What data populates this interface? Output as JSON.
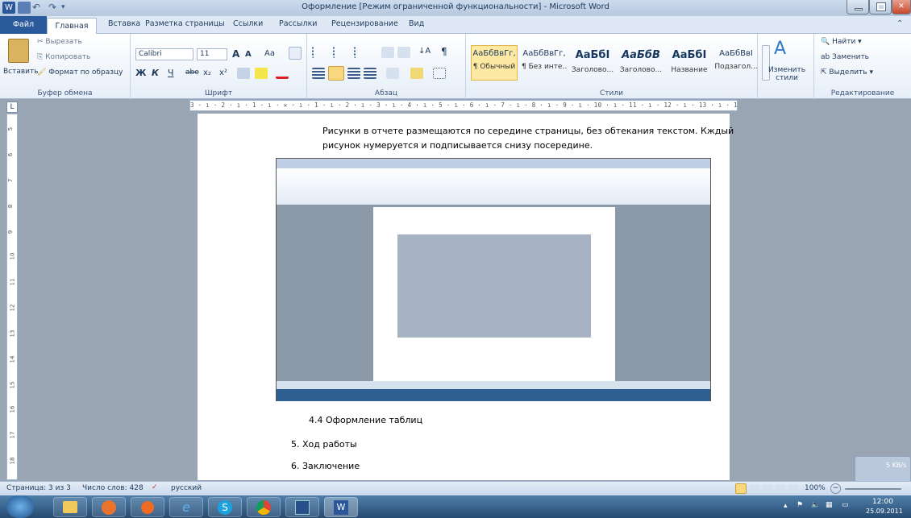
{
  "window": {
    "title": "Оформление [Режим ограниченной функциональности] - Microsoft Word"
  },
  "tabs": [
    "Файл",
    "Главная",
    "Вставка",
    "Разметка страницы",
    "Ссылки",
    "Рассылки",
    "Рецензирование",
    "Вид"
  ],
  "clipboard": {
    "paste": "Вставить",
    "cut": "Вырезать",
    "copy": "Копировать",
    "format_painter": "Формат по образцу",
    "group": "Буфер обмена"
  },
  "font": {
    "name": "Calibri",
    "size": "11",
    "group": "Шрифт",
    "bold": "Ж",
    "italic": "К",
    "underline": "Ч",
    "strike": "abe",
    "sub": "x₂",
    "sup": "x²",
    "grow": "A",
    "shrink": "A",
    "case": "Aa"
  },
  "paragraph": {
    "group": "Абзац"
  },
  "styles": {
    "group": "Стили",
    "change": "Изменить стили",
    "items": [
      {
        "sample": "АаБбВвГг,",
        "name": "¶ Обычный"
      },
      {
        "sample": "АаБбВвГг,",
        "name": "¶ Без инте..."
      },
      {
        "sample": "АаБбІ",
        "name": "Заголово..."
      },
      {
        "sample": "АаБбВ",
        "name": "Заголово..."
      },
      {
        "sample": "АаБбІ",
        "name": "Название"
      },
      {
        "sample": "АаБбВвІ",
        "name": "Подзагол..."
      }
    ]
  },
  "editing": {
    "find": "Найти",
    "replace": "Заменить",
    "select": "Выделить",
    "group": "Редактирование"
  },
  "ruler": {
    "h": "3 · ı · 2 · ı · 1 · ı · ✕ · ı · 1 · ı · 2 · ı · 3 · ı · 4 · ı · 5 · ı · 6 · ı · 7 · ı · 8 · ı · 9 · ı · 10 · ı · 11 · ı · 12 · ı · 13 · ı · 14 · ı · 15 · ı · 16 · △ · 17 · ı",
    "tab_btn": "L",
    "v": [
      "5",
      "6",
      "7",
      "8",
      "9",
      "10",
      "11",
      "12",
      "13",
      "14",
      "15",
      "16",
      "17",
      "18"
    ]
  },
  "doc": {
    "line1": "Рисунки в отчете размещаются по середине страницы, без обтекания текстом. Кждый",
    "line2": "рисунок нумеруется и подписывается снизу посередине.",
    "h44": "4.4  Оформление таблиц",
    "h5": "5.  Ход работы",
    "h6": "6.  Заключение"
  },
  "status": {
    "page": "Страница: 3 из 3",
    "words": "Число слов: 428",
    "lang": "русский",
    "zoom": "100%"
  },
  "tray": {
    "time": "12:00",
    "date": "25.09.2011",
    "net": "5 KB/s"
  },
  "taskbar_items": [
    "start",
    "explorer",
    "firefox",
    "media",
    "ie",
    "skype",
    "chrome",
    "app",
    "word"
  ]
}
